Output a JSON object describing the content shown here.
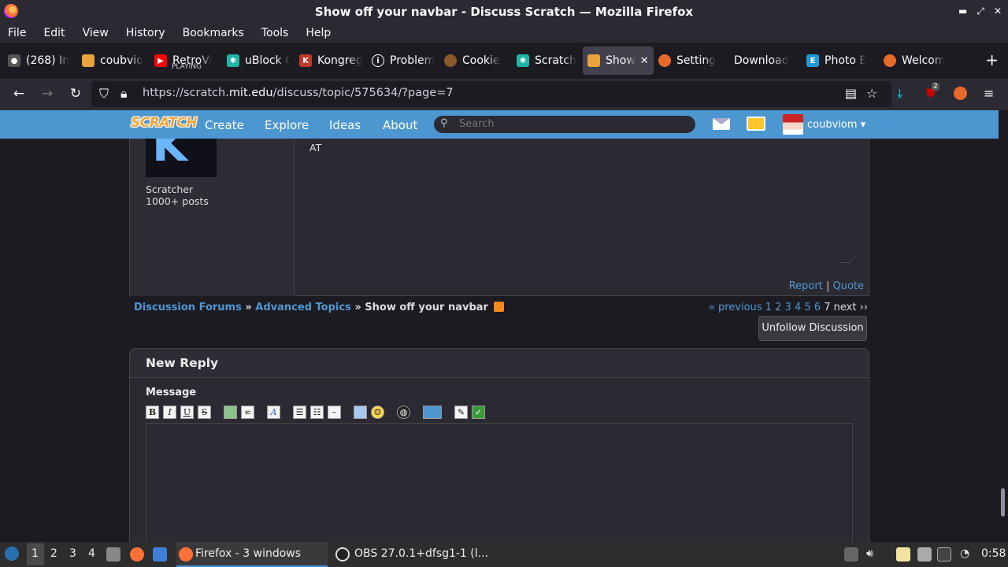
{
  "window": {
    "title": "Show off your navbar - Discuss Scratch — Mozilla Firefox"
  },
  "menu": [
    "File",
    "Edit",
    "View",
    "History",
    "Bookmarks",
    "Tools",
    "Help"
  ],
  "tabs": [
    {
      "label": "(268) In",
      "color": "#444"
    },
    {
      "label": "coubvio",
      "color": "#e8a33b"
    },
    {
      "label": "RetroVi",
      "sub": "PLAYING",
      "color": "#ff0000"
    },
    {
      "label": "uBlock C",
      "color": "#1fb5a7"
    },
    {
      "label": "Kongreg",
      "color": "#c0392b"
    },
    {
      "label": "Problem",
      "color": "#555"
    },
    {
      "label": "Cookie",
      "color": "#8a5a2b"
    },
    {
      "label": "Scratch",
      "color": "#1fb5a7"
    },
    {
      "label": "Show",
      "color": "#e8a33b",
      "active": true
    },
    {
      "label": "Setting",
      "color": "#e86a2b"
    },
    {
      "label": "Download",
      "color": "#1c1b22"
    },
    {
      "label": "Photo E",
      "color": "#1e9ad6"
    },
    {
      "label": "Welcom",
      "color": "#e86a2b"
    }
  ],
  "url": {
    "prefix": "https://scratch.",
    "host": "mit.edu",
    "path": "/discuss/topic/575634/?page=7"
  },
  "extension_badge": "2",
  "scratch_nav": {
    "logo": "SCRATCH",
    "links": [
      "Create",
      "Explore",
      "Ideas",
      "About"
    ],
    "search_placeholder": "Search",
    "username": "coubviom"
  },
  "post": {
    "rank": "Scratcher",
    "post_count": "1000+ posts",
    "body": "AT",
    "report": "Report",
    "separator": "|",
    "quote": "Quote"
  },
  "breadcrumb": {
    "forums": "Discussion Forums",
    "sep": "»",
    "category": "Advanced Topics",
    "topic": "Show off your navbar"
  },
  "pagination": {
    "previous": "« previous",
    "pages": [
      "1",
      "2",
      "3",
      "4",
      "5",
      "6"
    ],
    "current": "7",
    "next": "next ››"
  },
  "unfollow_label": "Unfollow Discussion",
  "reply": {
    "heading": "New Reply",
    "message_label": "Message"
  },
  "taskbar": {
    "workspaces": [
      "1",
      "2",
      "3",
      "4"
    ],
    "firefox_label": "Firefox - 3 windows",
    "obs_label": "OBS 27.0.1+dfsg1-1 (l...",
    "clock": "0:58"
  }
}
